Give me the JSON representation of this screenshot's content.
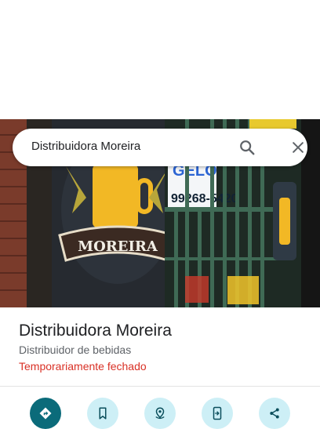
{
  "search": {
    "query": "Distribuidora Moreira",
    "icons": {
      "search": "search-icon",
      "clear": "close-icon"
    }
  },
  "photo": {
    "alt_icon": "storefront-photo",
    "sign_text": "MOREIRA",
    "sign_phone": "99268-5420",
    "sign_top": "GELO"
  },
  "place": {
    "name": "Distribuidora Moreira",
    "category": "Distribuidor de bebidas",
    "status": "Temporariamente fechado"
  },
  "actions": [
    {
      "name": "directions",
      "icon": "directions-icon"
    },
    {
      "name": "save",
      "icon": "bookmark-icon"
    },
    {
      "name": "nearby",
      "icon": "nearby-icon"
    },
    {
      "name": "send-to-phone",
      "icon": "send-to-phone-icon"
    },
    {
      "name": "share",
      "icon": "share-icon"
    }
  ],
  "colors": {
    "accent": "#0b6b7a",
    "action_bg": "#cdeff6",
    "status_closed": "#d93025"
  }
}
